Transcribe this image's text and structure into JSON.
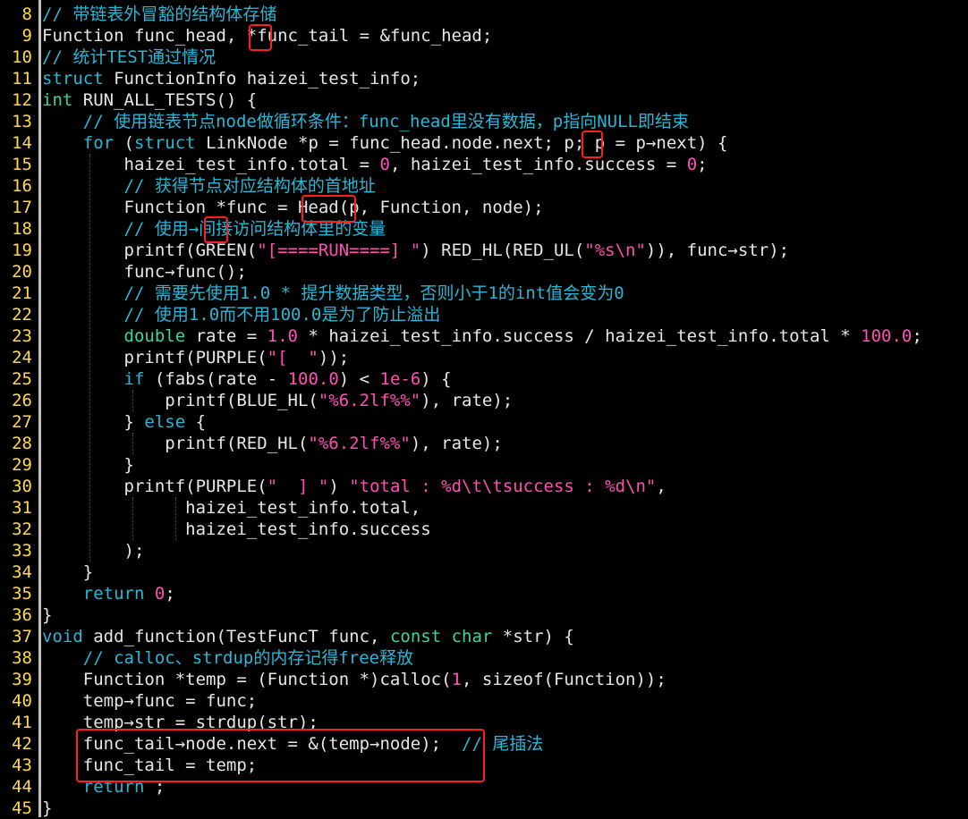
{
  "editor": {
    "lines": [
      {
        "number": "8",
        "tokens": [
          {
            "t": "// 带链表外冒豁的结构体存储",
            "c": "comment"
          }
        ]
      },
      {
        "number": "9",
        "tokens": [
          {
            "t": "Function func_head, *func_tail = &func_head;",
            "c": "default"
          }
        ]
      },
      {
        "number": "10",
        "tokens": [
          {
            "t": "// 统计TEST通过情况",
            "c": "comment"
          }
        ]
      },
      {
        "number": "11",
        "tokens": [
          {
            "t": "struct",
            "c": "keyword"
          },
          {
            "t": " FunctionInfo haizei_test_info;",
            "c": "default"
          }
        ]
      },
      {
        "number": "12",
        "tokens": [
          {
            "t": "int",
            "c": "type"
          },
          {
            "t": " RUN_ALL_TESTS() {",
            "c": "default"
          }
        ]
      },
      {
        "number": "13",
        "tokens": [
          {
            "t": "    // 使用链表节点node做循环条件：func_head里没有数据，p指向NULL即结束",
            "c": "comment"
          }
        ]
      },
      {
        "number": "14",
        "tokens": [
          {
            "t": "    ",
            "c": "default"
          },
          {
            "t": "for",
            "c": "keyword"
          },
          {
            "t": " (",
            "c": "default"
          },
          {
            "t": "struct",
            "c": "keyword"
          },
          {
            "t": " LinkNode *p = func_head.node.next; p; p = p→next) {",
            "c": "default"
          }
        ]
      },
      {
        "number": "15",
        "tokens": [
          {
            "t": "        haizei_test_info.total = ",
            "c": "default"
          },
          {
            "t": "0",
            "c": "number"
          },
          {
            "t": ", haizei_test_info.success = ",
            "c": "default"
          },
          {
            "t": "0",
            "c": "number"
          },
          {
            "t": ";",
            "c": "default"
          }
        ]
      },
      {
        "number": "16",
        "tokens": [
          {
            "t": "        // 获得节点对应结构体的首地址",
            "c": "comment"
          }
        ]
      },
      {
        "number": "17",
        "tokens": [
          {
            "t": "        Function *func = Head(p, Function, node);",
            "c": "default"
          }
        ]
      },
      {
        "number": "18",
        "tokens": [
          {
            "t": "        // 使用→间接访问结构体里的变量",
            "c": "comment"
          }
        ]
      },
      {
        "number": "19",
        "tokens": [
          {
            "t": "        printf(GREEN(",
            "c": "default"
          },
          {
            "t": "\"[====RUN====] \"",
            "c": "string"
          },
          {
            "t": ") RED_HL(RED_UL(",
            "c": "default"
          },
          {
            "t": "\"%s\\n\"",
            "c": "string"
          },
          {
            "t": ")), func→str);",
            "c": "default"
          }
        ]
      },
      {
        "number": "20",
        "tokens": [
          {
            "t": "        func→func();",
            "c": "default"
          }
        ]
      },
      {
        "number": "21",
        "tokens": [
          {
            "t": "        // 需要先使用1.0 * 提升数据类型，否则小于1的int值会变为0",
            "c": "comment"
          }
        ]
      },
      {
        "number": "22",
        "tokens": [
          {
            "t": "        // 使用1.0而不用100.0是为了防止溢出",
            "c": "comment"
          }
        ]
      },
      {
        "number": "23",
        "tokens": [
          {
            "t": "        ",
            "c": "default"
          },
          {
            "t": "double",
            "c": "type"
          },
          {
            "t": " rate = ",
            "c": "default"
          },
          {
            "t": "1.0",
            "c": "number"
          },
          {
            "t": " * haizei_test_info.success / haizei_test_info.total * ",
            "c": "default"
          },
          {
            "t": "100.0",
            "c": "number"
          },
          {
            "t": ";",
            "c": "default"
          }
        ]
      },
      {
        "number": "24",
        "tokens": [
          {
            "t": "        printf(PURPLE(",
            "c": "default"
          },
          {
            "t": "\"[  \"",
            "c": "string"
          },
          {
            "t": "));",
            "c": "default"
          }
        ]
      },
      {
        "number": "25",
        "tokens": [
          {
            "t": "        ",
            "c": "default"
          },
          {
            "t": "if",
            "c": "keyword"
          },
          {
            "t": " (fabs(rate - ",
            "c": "default"
          },
          {
            "t": "100.0",
            "c": "number"
          },
          {
            "t": ") < ",
            "c": "default"
          },
          {
            "t": "1e-6",
            "c": "number"
          },
          {
            "t": ") {",
            "c": "default"
          }
        ]
      },
      {
        "number": "26",
        "tokens": [
          {
            "t": "            printf(BLUE_HL(",
            "c": "default"
          },
          {
            "t": "\"%6.2lf%%\"",
            "c": "string"
          },
          {
            "t": "), rate);",
            "c": "default"
          }
        ]
      },
      {
        "number": "27",
        "tokens": [
          {
            "t": "        } ",
            "c": "default"
          },
          {
            "t": "else",
            "c": "keyword"
          },
          {
            "t": " {",
            "c": "default"
          }
        ]
      },
      {
        "number": "28",
        "tokens": [
          {
            "t": "            printf(RED_HL(",
            "c": "default"
          },
          {
            "t": "\"%6.2lf%%\"",
            "c": "string"
          },
          {
            "t": "), rate);",
            "c": "default"
          }
        ]
      },
      {
        "number": "29",
        "tokens": [
          {
            "t": "        }",
            "c": "default"
          }
        ]
      },
      {
        "number": "30",
        "tokens": [
          {
            "t": "        printf(PURPLE(",
            "c": "default"
          },
          {
            "t": "\"  ] \"",
            "c": "string"
          },
          {
            "t": ") ",
            "c": "default"
          },
          {
            "t": "\"total : %d\\t\\tsuccess : %d\\n\"",
            "c": "string"
          },
          {
            "t": ",",
            "c": "default"
          }
        ]
      },
      {
        "number": "31",
        "tokens": [
          {
            "t": "              haizei_test_info.total,",
            "c": "default"
          }
        ]
      },
      {
        "number": "32",
        "tokens": [
          {
            "t": "              haizei_test_info.success",
            "c": "default"
          }
        ]
      },
      {
        "number": "33",
        "tokens": [
          {
            "t": "        );",
            "c": "default"
          }
        ]
      },
      {
        "number": "34",
        "tokens": [
          {
            "t": "    }",
            "c": "default"
          }
        ]
      },
      {
        "number": "35",
        "tokens": [
          {
            "t": "    ",
            "c": "default"
          },
          {
            "t": "return",
            "c": "keyword"
          },
          {
            "t": " ",
            "c": "default"
          },
          {
            "t": "0",
            "c": "number"
          },
          {
            "t": ";",
            "c": "default"
          }
        ]
      },
      {
        "number": "36",
        "tokens": [
          {
            "t": "}",
            "c": "default"
          }
        ]
      },
      {
        "number": "37",
        "tokens": [
          {
            "t": "void",
            "c": "keyword"
          },
          {
            "t": " add_function(TestFuncT func, ",
            "c": "default"
          },
          {
            "t": "const",
            "c": "type"
          },
          {
            "t": " ",
            "c": "default"
          },
          {
            "t": "char",
            "c": "type"
          },
          {
            "t": " *str) {",
            "c": "default"
          }
        ]
      },
      {
        "number": "38",
        "tokens": [
          {
            "t": "    // calloc、strdup的内存记得free释放",
            "c": "comment"
          }
        ]
      },
      {
        "number": "39",
        "tokens": [
          {
            "t": "    Function *temp = (Function *)calloc(",
            "c": "default"
          },
          {
            "t": "1",
            "c": "number"
          },
          {
            "t": ", sizeof(Function));",
            "c": "default"
          }
        ]
      },
      {
        "number": "40",
        "tokens": [
          {
            "t": "    temp→func = func;",
            "c": "default"
          }
        ]
      },
      {
        "number": "41",
        "tokens": [
          {
            "t": "    temp→str = strdup(str);",
            "c": "default"
          }
        ]
      },
      {
        "number": "42",
        "tokens": [
          {
            "t": "    func_tail→node.next = &(temp→node);  ",
            "c": "default"
          },
          {
            "t": "// 尾插法",
            "c": "comment"
          }
        ]
      },
      {
        "number": "43",
        "tokens": [
          {
            "t": "    func_tail = temp;",
            "c": "default"
          }
        ]
      },
      {
        "number": "44",
        "tokens": [
          {
            "t": "    ",
            "c": "default"
          },
          {
            "t": "return",
            "c": "keyword"
          },
          {
            "t": " ;",
            "c": "default"
          }
        ]
      },
      {
        "number": "45",
        "tokens": [
          {
            "t": "}",
            "c": "default"
          }
        ]
      }
    ]
  },
  "colors": {
    "background": "#000000",
    "line_number": "#ffd94a",
    "comment": "#29b7d6",
    "keyword": "#29b7d6",
    "type": "#3fd39a",
    "literal": "#ff4fb4",
    "annotation_box": "#ff1f1f"
  }
}
